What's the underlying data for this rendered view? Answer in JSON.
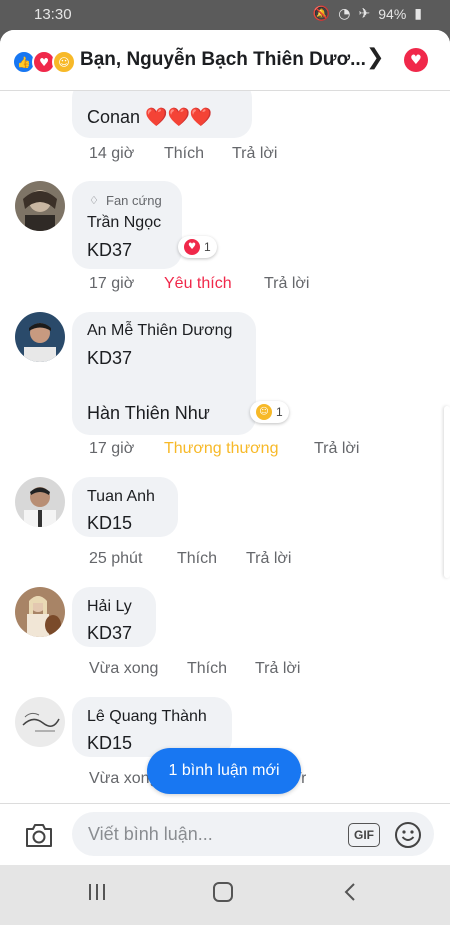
{
  "status_bar": {
    "time": "13:30",
    "battery": "94%"
  },
  "header": {
    "names": "Bạn, Nguyễn Bạch Thiên Dươ...",
    "reaction_icons": [
      "like-icon",
      "love-icon",
      "care-icon"
    ],
    "colors": {
      "like": "#1877f2",
      "love": "#f0284a",
      "care": "#f7b928"
    }
  },
  "comments": [
    {
      "name": "",
      "text": "Conan ❤️❤️❤️",
      "time": "14 giờ",
      "action": "Thích",
      "reply": "Trả lời"
    },
    {
      "badge": "Fan cứng",
      "name": "Trần Ngọc",
      "text": "KD37",
      "reaction_count": "1",
      "time": "17 giờ",
      "action": "Yêu thích",
      "action_color": "#f0284a",
      "reply": "Trả lời"
    },
    {
      "name": "An Mễ Thiên Dương",
      "lines": [
        "KD37",
        "Hàn Thiên Như"
      ],
      "reaction_count": "1",
      "time": "17 giờ",
      "action": "Thương thương",
      "action_color": "#f7b928",
      "reply": "Trả lời"
    },
    {
      "name": "Tuan Anh",
      "text": "KD15",
      "time": "25 phút",
      "action": "Thích",
      "reply": "Trả lời"
    },
    {
      "name": "Hải Ly",
      "text": "KD37",
      "time": "Vừa xong",
      "action": "Thích",
      "reply": "Trả lời"
    },
    {
      "name": "Lê Quang Thành",
      "text": "KD15",
      "time": "Vừa xong",
      "reply": "Trả lời"
    }
  ],
  "new_comment_pill": "1 bình luận mới",
  "composer": {
    "placeholder": "Viết bình luận...",
    "gif_label": "GIF"
  }
}
